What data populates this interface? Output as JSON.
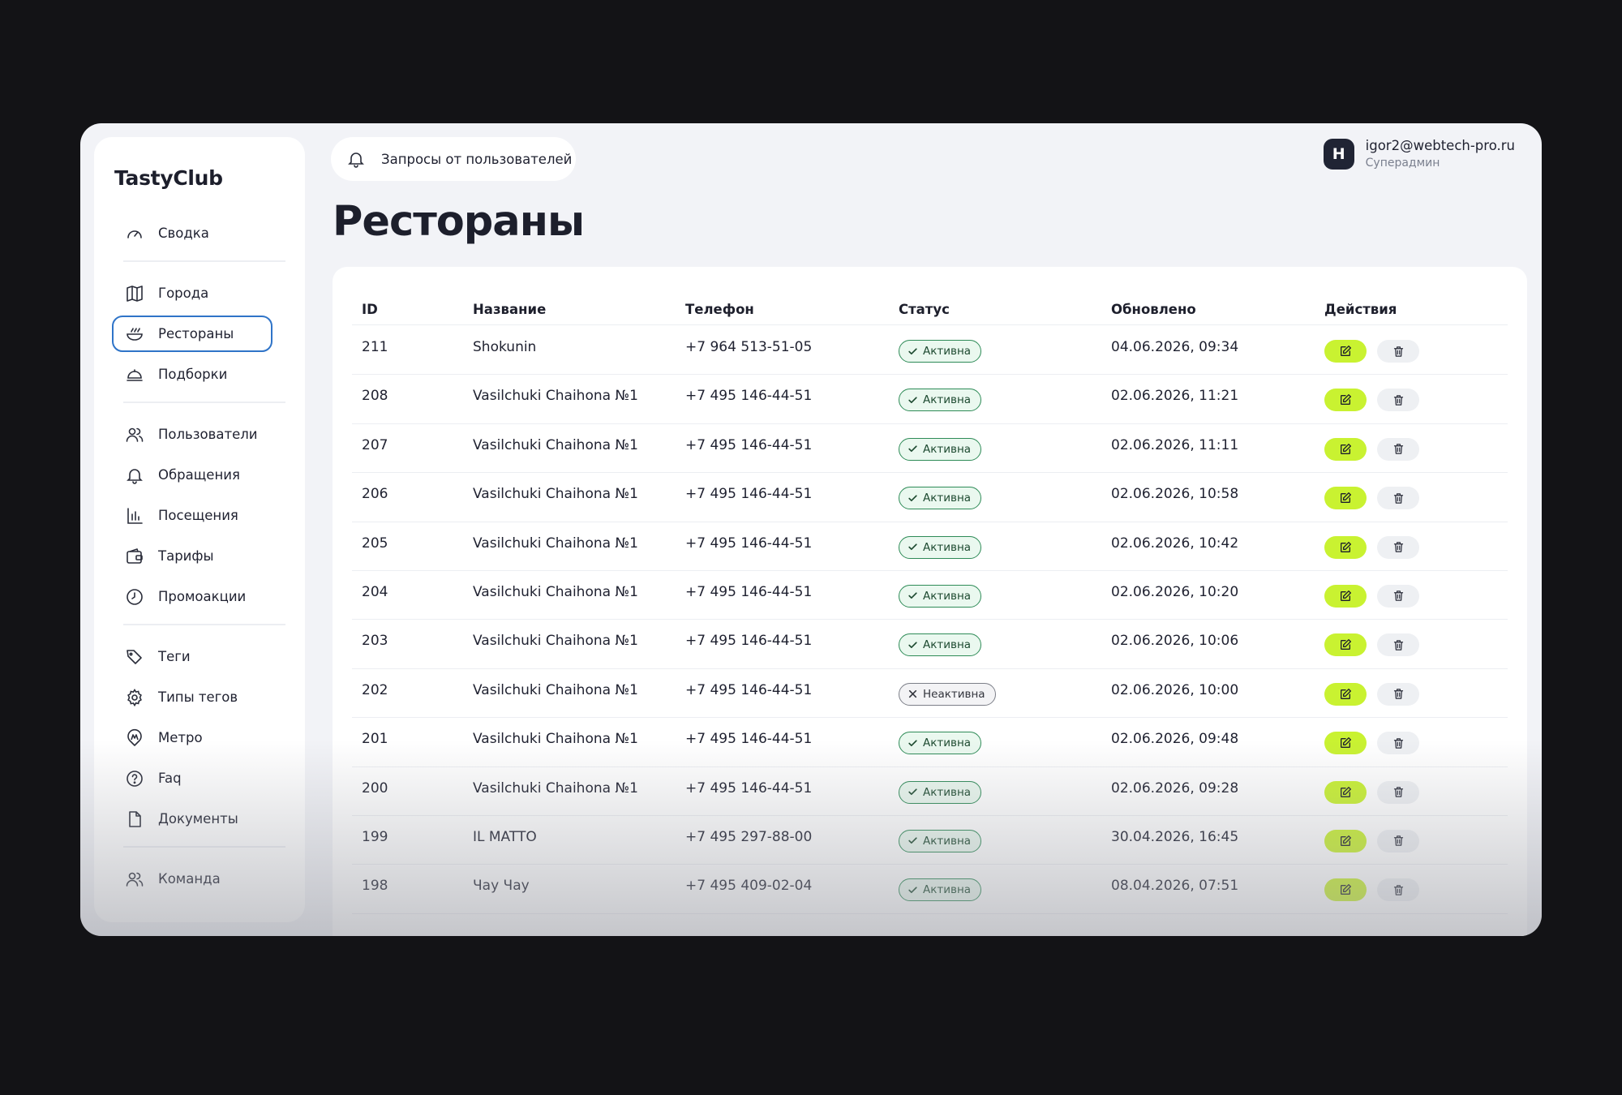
{
  "app": {
    "logo": "TastyClub"
  },
  "sidebar": {
    "items": [
      {
        "label": "Сводка",
        "icon": "gauge-icon"
      },
      {
        "label": "Города",
        "icon": "map-icon"
      },
      {
        "label": "Рестораны",
        "icon": "bowl-icon",
        "active": true
      },
      {
        "label": "Подборки",
        "icon": "dish-cover-icon"
      },
      {
        "label": "Пользователи",
        "icon": "users-icon"
      },
      {
        "label": "Обращения",
        "icon": "bell-icon"
      },
      {
        "label": "Посещения",
        "icon": "bar-chart-icon"
      },
      {
        "label": "Тарифы",
        "icon": "wallet-icon"
      },
      {
        "label": "Промоакции",
        "icon": "clock-icon"
      },
      {
        "label": "Теги",
        "icon": "tags-icon"
      },
      {
        "label": "Типы тегов",
        "icon": "gear-icon"
      },
      {
        "label": "Метро",
        "icon": "metro-icon"
      },
      {
        "label": "Faq",
        "icon": "question-icon"
      },
      {
        "label": "Документы",
        "icon": "document-icon"
      },
      {
        "label": "Команда",
        "icon": "team-icon"
      }
    ]
  },
  "header": {
    "requests_label": "Запросы от пользователей",
    "user": {
      "initial": "Н",
      "email": "igor2@webtech-pro.ru",
      "role": "Суперадмин"
    }
  },
  "page": {
    "title": "Рестораны"
  },
  "table": {
    "columns": [
      "ID",
      "Название",
      "Телефон",
      "Статус",
      "Обновлено",
      "Действия"
    ],
    "rows": [
      {
        "id": "211",
        "name": "Shokunin",
        "phone": "+7 964 513-51-05",
        "status": "Активна",
        "active": true,
        "updated": "04.06.2026, 09:34"
      },
      {
        "id": "208",
        "name": "Vasilchuki Chaihona №1",
        "phone": "+7 495 146-44-51",
        "status": "Активна",
        "active": true,
        "updated": "02.06.2026, 11:21"
      },
      {
        "id": "207",
        "name": "Vasilchuki Chaihona №1",
        "phone": "+7 495 146-44-51",
        "status": "Активна",
        "active": true,
        "updated": "02.06.2026, 11:11"
      },
      {
        "id": "206",
        "name": "Vasilchuki Chaihona №1",
        "phone": "+7 495 146-44-51",
        "status": "Активна",
        "active": true,
        "updated": "02.06.2026, 10:58"
      },
      {
        "id": "205",
        "name": "Vasilchuki Chaihona №1",
        "phone": "+7 495 146-44-51",
        "status": "Активна",
        "active": true,
        "updated": "02.06.2026, 10:42"
      },
      {
        "id": "204",
        "name": "Vasilchuki Chaihona №1",
        "phone": "+7 495 146-44-51",
        "status": "Активна",
        "active": true,
        "updated": "02.06.2026, 10:20"
      },
      {
        "id": "203",
        "name": "Vasilchuki Chaihona №1",
        "phone": "+7 495 146-44-51",
        "status": "Активна",
        "active": true,
        "updated": "02.06.2026, 10:06"
      },
      {
        "id": "202",
        "name": "Vasilchuki Chaihona №1",
        "phone": "+7 495 146-44-51",
        "status": "Неактивна",
        "active": false,
        "updated": "02.06.2026, 10:00"
      },
      {
        "id": "201",
        "name": "Vasilchuki Chaihona №1",
        "phone": "+7 495 146-44-51",
        "status": "Активна",
        "active": true,
        "updated": "02.06.2026, 09:48"
      },
      {
        "id": "200",
        "name": "Vasilchuki Chaihona №1",
        "phone": "+7 495 146-44-51",
        "status": "Активна",
        "active": true,
        "updated": "02.06.2026, 09:28"
      },
      {
        "id": "199",
        "name": "IL MATTO",
        "phone": "+7 495 297-88-00",
        "status": "Активна",
        "active": true,
        "updated": "30.04.2026, 16:45"
      },
      {
        "id": "198",
        "name": "Чау Чау",
        "phone": "+7 495 409-02-04",
        "status": "Активна",
        "active": true,
        "updated": "08.04.2026, 07:51"
      }
    ]
  },
  "colors": {
    "background": "#131316",
    "window": "#f2f3f7",
    "accent_edit": "#c9f231",
    "active_nav_border": "#2f74c8",
    "status_active": "#2e8b57"
  }
}
